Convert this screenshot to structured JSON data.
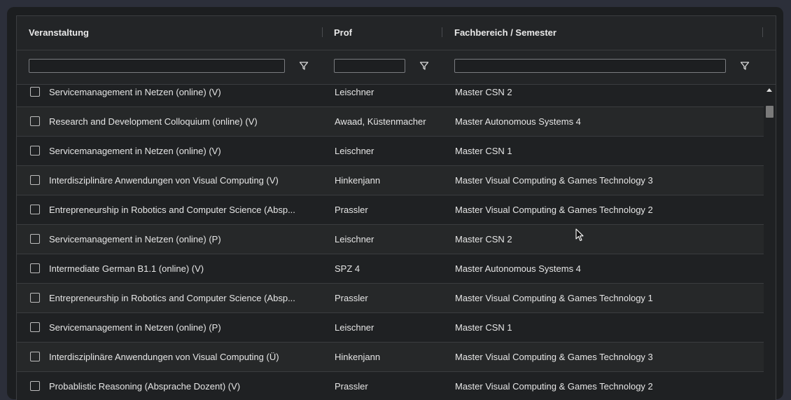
{
  "columns": [
    {
      "title": "Veranstaltung"
    },
    {
      "title": "Prof"
    },
    {
      "title": "Fachbereich / Semester"
    }
  ],
  "filters": {
    "veranstaltung": "",
    "prof": "",
    "fachbereich": ""
  },
  "icons": {
    "filter": "filter-icon",
    "checkbox": "checkbox-icon",
    "scroll_up": "chevron-up-icon",
    "cursor": "mouse-pointer-icon"
  },
  "colors": {
    "background": "#2c2f3a",
    "panel": "#1c1e20",
    "grid": "#232527",
    "text": "#e6e6e6"
  },
  "rows": [
    {
      "veranstaltung": "Servicemanagement in Netzen (online) (V)",
      "prof": "Leischner",
      "fachbereich": "Master CSN 2"
    },
    {
      "veranstaltung": "Research and Development Colloquium (online) (V)",
      "prof": "Awaad, Küstenmacher",
      "fachbereich": "Master Autonomous Systems 4"
    },
    {
      "veranstaltung": "Servicemanagement in Netzen (online) (V)",
      "prof": "Leischner",
      "fachbereich": "Master CSN 1"
    },
    {
      "veranstaltung": "Interdisziplinäre Anwendungen von Visual Computing (V)",
      "prof": "Hinkenjann",
      "fachbereich": "Master Visual Computing & Games Technology 3"
    },
    {
      "veranstaltung": "Entrepreneurship in Robotics and Computer Science (Absp...",
      "prof": "Prassler",
      "fachbereich": "Master Visual Computing & Games Technology 2"
    },
    {
      "veranstaltung": "Servicemanagement in Netzen (online) (P)",
      "prof": "Leischner",
      "fachbereich": "Master CSN 2"
    },
    {
      "veranstaltung": "Intermediate German B1.1 (online) (V)",
      "prof": "SPZ 4",
      "fachbereich": "Master Autonomous Systems 4"
    },
    {
      "veranstaltung": "Entrepreneurship in Robotics and Computer Science (Absp...",
      "prof": "Prassler",
      "fachbereich": "Master Visual Computing & Games Technology 1"
    },
    {
      "veranstaltung": "Servicemanagement in Netzen (online) (P)",
      "prof": "Leischner",
      "fachbereich": "Master CSN 1"
    },
    {
      "veranstaltung": "Interdisziplinäre Anwendungen von Visual Computing (Ü)",
      "prof": "Hinkenjann",
      "fachbereich": "Master Visual Computing & Games Technology 3"
    },
    {
      "veranstaltung": "Probablistic Reasoning (Absprache Dozent) (V)",
      "prof": "Prassler",
      "fachbereich": "Master Visual Computing & Games Technology 2"
    }
  ]
}
